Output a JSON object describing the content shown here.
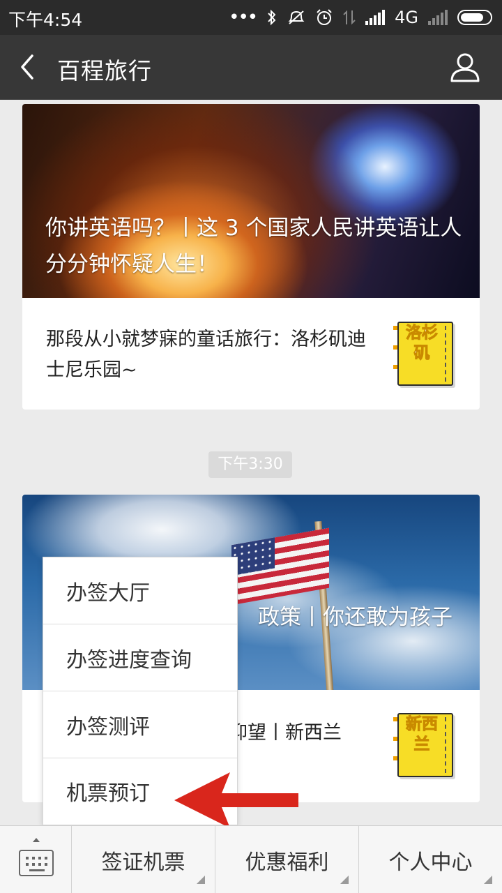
{
  "status_bar": {
    "time": "下午4:54",
    "network": "4G",
    "icons": [
      "more-dots-icon",
      "bluetooth-icon",
      "mute-icon",
      "alarm-icon",
      "data-transfer-icon",
      "signal-icon",
      "signal-2-icon",
      "battery-icon"
    ]
  },
  "titlebar": {
    "title": "百程旅行",
    "back_icon": "back-chevron-icon",
    "profile_icon": "user-icon"
  },
  "articles": [
    {
      "headline": "你讲英语吗？丨这 3 个国家人民讲英语让人分分钟怀疑人生！",
      "summary": "那段从小就梦寐的童话旅行：洛杉矶迪士尼乐园~",
      "thumb_text": "洛杉矶"
    },
    {
      "headline": "政策丨你还敢为孩子",
      "summary": "仰望丨新西兰",
      "thumb_text": "新西兰"
    }
  ],
  "timestamp": "下午3:30",
  "popup_menu": {
    "items": [
      "办签大厅",
      "办签进度查询",
      "办签测评",
      "机票预订"
    ]
  },
  "colors": {
    "status_bar": "#2b2b2b",
    "title_bar": "#373737",
    "arrow": "#d9261c",
    "thumb_yellow": "#f7dd26"
  },
  "bottom_menu": {
    "keyboard_icon": "keyboard-icon",
    "tabs": [
      "签证机票",
      "优惠福利",
      "个人中心"
    ]
  }
}
